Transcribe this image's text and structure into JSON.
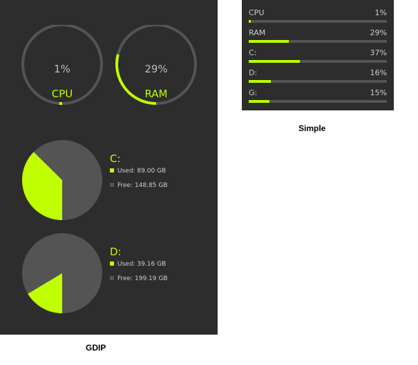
{
  "colors": {
    "accent": "#bfff00",
    "track": "#545454",
    "panel_bg": "#2d2d2d",
    "text": "#bdbdbd"
  },
  "gdip": {
    "caption": "GDIP",
    "gauges": [
      {
        "id": "cpu",
        "value_text": "1%",
        "label": "CPU",
        "fraction": 0.01
      },
      {
        "id": "ram",
        "value_text": "29%",
        "label": "RAM",
        "fraction": 0.29
      }
    ],
    "drives": [
      {
        "id": "c",
        "letter": "C:",
        "used_text": "Used: 89.00 GB",
        "free_text": "Free: 148.85 GB",
        "used_fraction": 0.374
      },
      {
        "id": "d",
        "letter": "D:",
        "used_text": "Used: 39.16 GB",
        "free_text": "Free: 199.19 GB",
        "used_fraction": 0.164
      }
    ]
  },
  "simple": {
    "caption": "Simple",
    "rows": [
      {
        "label": "CPU",
        "value_text": "1%",
        "fraction": 0.01
      },
      {
        "label": "RAM",
        "value_text": "29%",
        "fraction": 0.29
      },
      {
        "label": "C:",
        "value_text": "37%",
        "fraction": 0.37
      },
      {
        "label": "D:",
        "value_text": "16%",
        "fraction": 0.16
      },
      {
        "label": "G:",
        "value_text": "15%",
        "fraction": 0.15
      }
    ]
  }
}
